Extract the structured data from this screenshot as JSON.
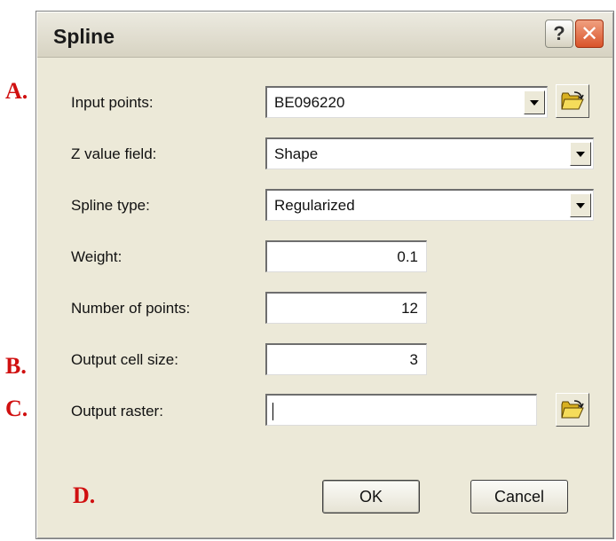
{
  "annotations": [
    "A.",
    "B.",
    "C.",
    "D."
  ],
  "dialog": {
    "title": "Spline",
    "help_label": "?",
    "close_label": "✕"
  },
  "form": {
    "input_points": {
      "label": "Input points:",
      "value": "BE096220",
      "icon": "folder-open-icon"
    },
    "z_value_field": {
      "label": "Z value field:",
      "value": "Shape"
    },
    "spline_type": {
      "label": "Spline type:",
      "value": "Regularized"
    },
    "weight": {
      "label": "Weight:",
      "value": "0.1"
    },
    "number_of_points": {
      "label": "Number of points:",
      "value": "12"
    },
    "output_cell_size": {
      "label": "Output cell size:",
      "value": "3"
    },
    "output_raster": {
      "label": "Output raster:",
      "value": "",
      "icon": "folder-open-icon"
    }
  },
  "buttons": {
    "ok": "OK",
    "cancel": "Cancel"
  }
}
